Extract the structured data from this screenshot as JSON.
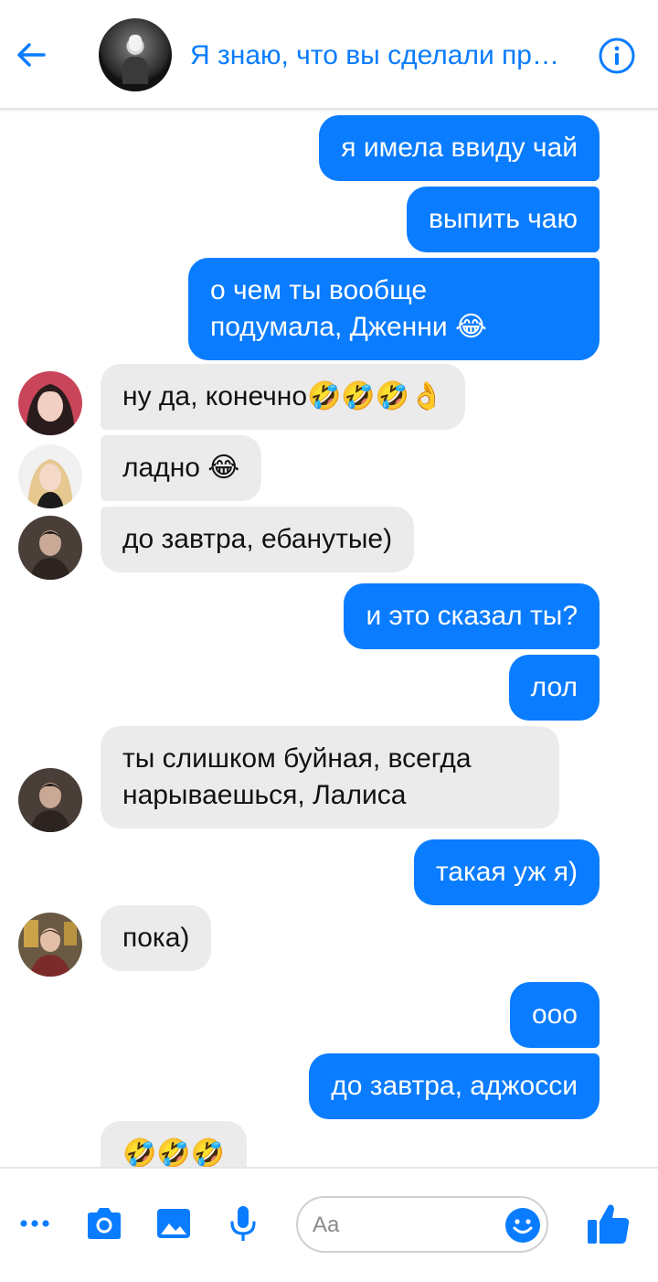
{
  "header": {
    "title": "Я знаю, что вы сделали прошлым летом",
    "accent": "#0a7cff"
  },
  "messages": [
    {
      "dir": "out",
      "text": "я имела ввиду чай"
    },
    {
      "dir": "out",
      "text": "выпить чаю"
    },
    {
      "dir": "out",
      "lines": [
        "о чем ты вообще",
        "подумала, Дженни 😂"
      ]
    },
    {
      "dir": "in",
      "avatar": "jennie",
      "text": "ну да, конечно🤣🤣🤣👌"
    },
    {
      "dir": "in",
      "avatar": "blonde",
      "text": "ладно 😂"
    },
    {
      "dir": "in",
      "avatar": "boy",
      "text": "до завтра, ебанутые)"
    },
    {
      "dir": "out",
      "text": "и это сказал ты?"
    },
    {
      "dir": "out",
      "text": "лол"
    },
    {
      "dir": "in",
      "avatar": "boy",
      "lines": [
        "ты слишком буйная, всегда",
        "нарываешься, Лалиса"
      ]
    },
    {
      "dir": "out",
      "text": "такая уж я)"
    },
    {
      "dir": "in",
      "avatar": "jin",
      "text": "пока)"
    },
    {
      "dir": "out",
      "text": "ооо"
    },
    {
      "dir": "out",
      "text": "до завтра, аджосси"
    },
    {
      "dir": "in",
      "text": "🤣🤣🤣"
    }
  ],
  "composer": {
    "placeholder": "Aa",
    "icons": [
      "more-icon",
      "camera-icon",
      "image-icon",
      "microphone-icon",
      "emoji-icon",
      "thumbs-up-icon"
    ]
  },
  "colors": {
    "outgoing_bubble": "#0a7cff",
    "incoming_bubble": "#ebebeb"
  }
}
